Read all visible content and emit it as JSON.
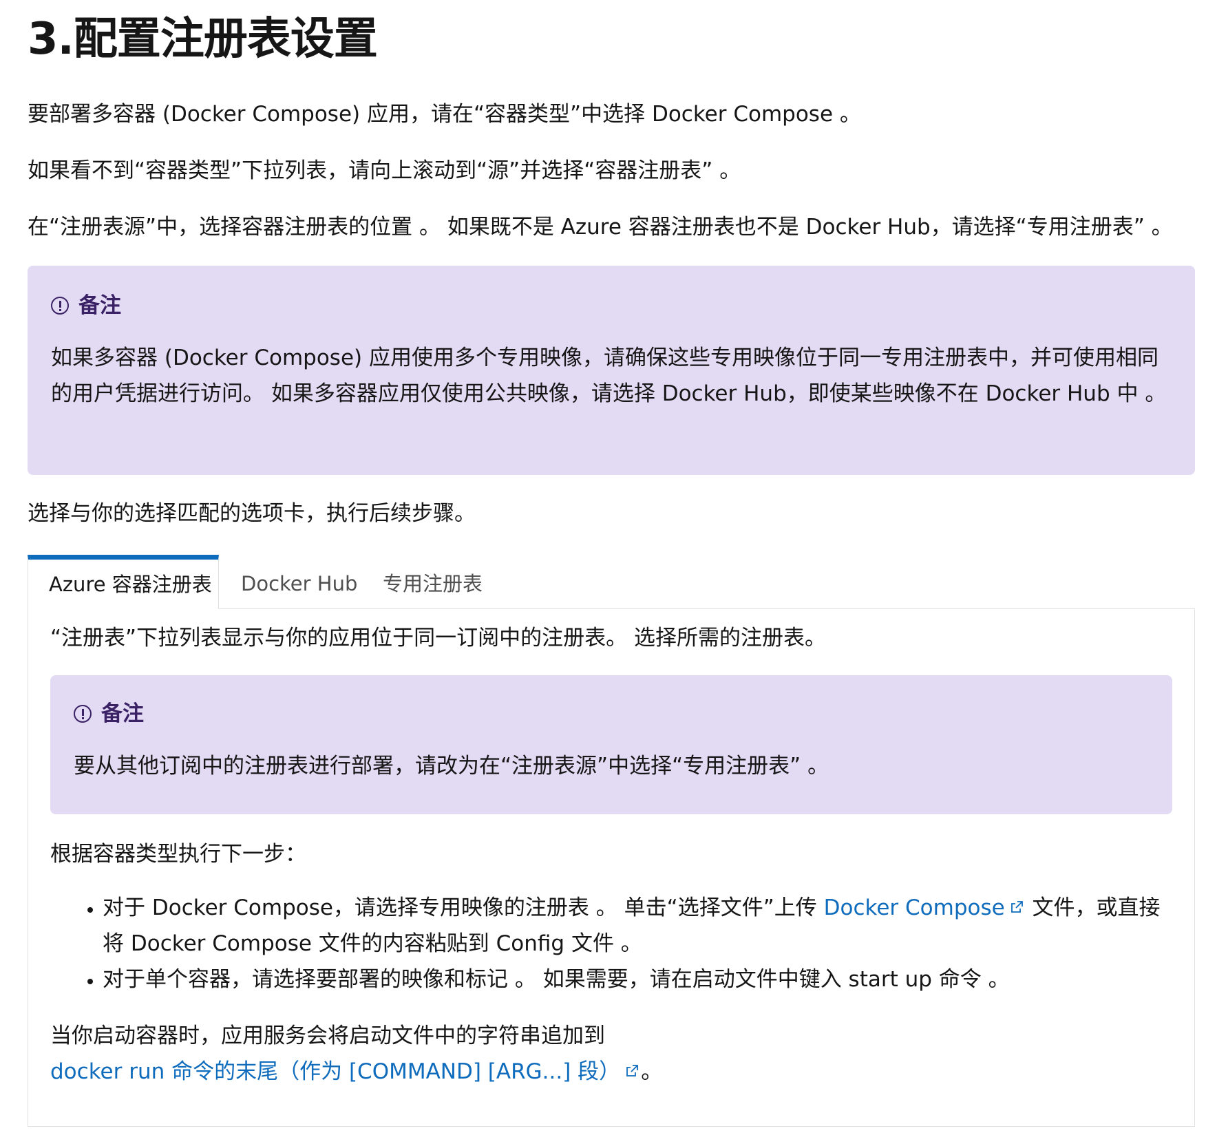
{
  "heading": "3.配置注册表设置",
  "paragraphs": {
    "p1": "要部署多容器 (Docker Compose) 应用，请在“容器类型”中选择 Docker Compose 。",
    "p2": "如果看不到“容器类型”下拉列表，请向上滚动到“源”并选择“容器注册表” 。",
    "p3": "在“注册表源”中，选择容器注册表的位置 。 如果既不是 Azure 容器注册表也不是 Docker Hub，请选择“专用注册表” 。",
    "p4": "选择与你的选择匹配的选项卡，执行后续步骤。"
  },
  "note1": {
    "title": "备注",
    "body": "如果多容器 (Docker Compose) 应用使用多个专用映像，请确保这些专用映像位于同一专用注册表中，并可使用相同的用户凭据进行访问。 如果多容器应用仅使用公共映像，请选择 Docker Hub，即使某些映像不在 Docker Hub 中 。"
  },
  "tabs": [
    {
      "label": "Azure 容器注册表",
      "active": true
    },
    {
      "label": "Docker Hub",
      "active": false
    },
    {
      "label": "专用注册表",
      "active": false
    }
  ],
  "panel": {
    "p1": "“注册表”下拉列表显示与你的应用位于同一订阅中的注册表。 选择所需的注册表。",
    "note2": {
      "title": "备注",
      "body": "要从其他订阅中的注册表进行部署，请改为在“注册表源”中选择“专用注册表” 。"
    },
    "p2": "根据容器类型执行下一步：",
    "list": {
      "item1_pre": "对于 Docker Compose，请选择专用映像的注册表 。 单击“选择文件”上传 ",
      "item1_link": "Docker Compose",
      "item1_post": " 文件，或直接将 Docker Compose 文件的内容粘贴到 Config 文件 。",
      "item2": "对于单个容器，请选择要部署的映像和标记 。 如果需要，请在启动文件中键入 start up 命令 。"
    },
    "p3_pre": "当你启动容器时，应用服务会将启动文件中的字符串追加到 ",
    "p3_link": "docker run 命令的末尾（作为 [COMMAND] [ARG...] 段）",
    "p3_post": "。"
  },
  "colors": {
    "accent": "#0f6cbd",
    "note_bg": "#e3daf3",
    "note_title": "#3b2266"
  }
}
